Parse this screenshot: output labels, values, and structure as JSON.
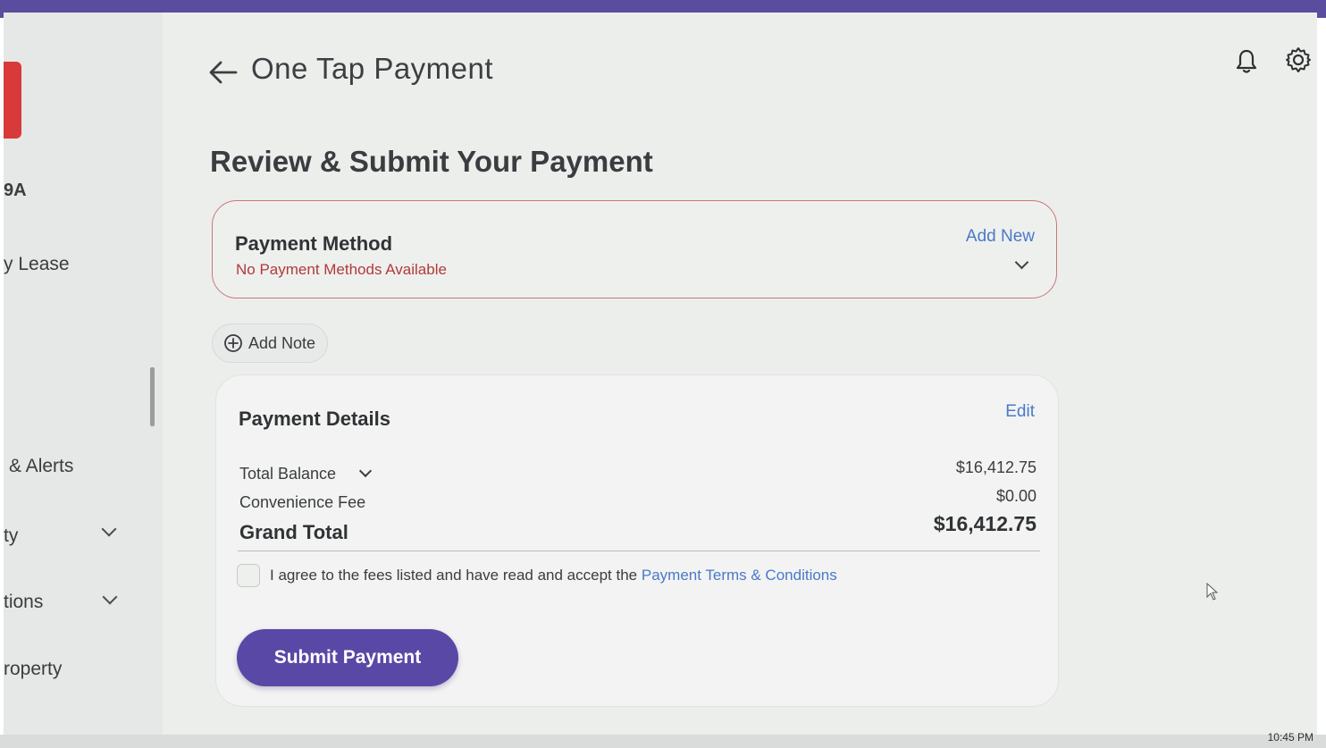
{
  "header": {
    "title": "One Tap Payment"
  },
  "sidebar": {
    "code": "9A",
    "items": [
      {
        "label": "y Lease"
      },
      {
        "label": "& Alerts"
      },
      {
        "label": "ty"
      },
      {
        "label": "tions"
      },
      {
        "label": "roperty"
      }
    ]
  },
  "main": {
    "heading": "Review & Submit Your Payment",
    "payment_method": {
      "title": "Payment Method",
      "status": "No Payment Methods Available",
      "add_new_label": "Add New"
    },
    "add_note_label": "Add Note",
    "payment_details": {
      "title": "Payment Details",
      "edit_label": "Edit",
      "total_balance_label": "Total Balance",
      "total_balance_value": "$16,412.75",
      "convenience_fee_label": "Convenience Fee",
      "convenience_fee_value": "$0.00",
      "grand_total_label": "Grand Total",
      "grand_total_value": "$16,412.75",
      "agree_text": "I agree to the fees listed and have read and accept the",
      "terms_link": "Payment Terms & Conditions",
      "submit_label": "Submit Payment"
    }
  },
  "taskbar": {
    "clock": "10:45 PM"
  },
  "colors": {
    "accent": "#5a48a6",
    "link": "#4a79c8",
    "error": "#b03a3a",
    "brand_red": "#d83a3a"
  },
  "icons": [
    "back-arrow-icon",
    "bell-icon",
    "gear-icon",
    "plus-circle-icon",
    "chevron-down-icon"
  ]
}
